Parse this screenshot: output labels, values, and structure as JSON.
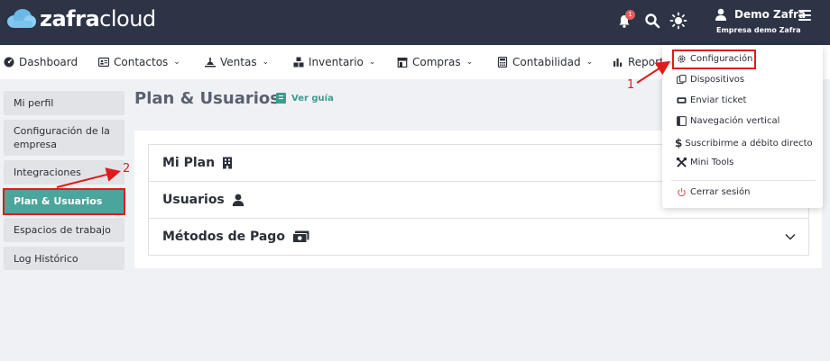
{
  "app": {
    "logo_bold": "zafra",
    "logo_light": "cloud",
    "notification_count": "1",
    "user_name": "Demo Zafra",
    "company_name": "Empresa demo Zafra"
  },
  "nav": {
    "items": [
      {
        "label": "Dashboard",
        "icon": "dashboard-icon",
        "dropdown": false
      },
      {
        "label": "Contactos",
        "icon": "contacts-icon",
        "dropdown": true
      },
      {
        "label": "Ventas",
        "icon": "sales-icon",
        "dropdown": true
      },
      {
        "label": "Inventario",
        "icon": "inventory-icon",
        "dropdown": true
      },
      {
        "label": "Compras",
        "icon": "store-icon",
        "dropdown": true
      },
      {
        "label": "Contabilidad",
        "icon": "calculator-icon",
        "dropdown": true
      },
      {
        "label": "Reporte",
        "icon": "chart-icon",
        "dropdown": false
      }
    ]
  },
  "sidebar": {
    "items": [
      {
        "label": "Mi perfil"
      },
      {
        "label": "Configuración de la empresa"
      },
      {
        "label": "Integraciones"
      },
      {
        "label": "Plan & Usuarios",
        "active": true
      },
      {
        "label": "Espacios de trabajo"
      },
      {
        "label": "Log Histórico"
      }
    ]
  },
  "main": {
    "title": "Plan & Usuarios",
    "guide_label": "Ver guía",
    "sections": [
      {
        "label": "Mi Plan",
        "icon": "building-icon"
      },
      {
        "label": "Usuarios",
        "icon": "user-icon"
      },
      {
        "label": "Métodos de Pago",
        "icon": "money-icon"
      }
    ]
  },
  "user_menu": {
    "items": [
      {
        "label": "Configuración",
        "icon": "gear-icon"
      },
      {
        "label": "Dispositivos",
        "icon": "devices-icon"
      },
      {
        "label": "Enviar ticket",
        "icon": "ticket-icon"
      },
      {
        "label": "Navegación vertical",
        "icon": "layout-icon"
      },
      {
        "label": "Suscribirme a débito directo",
        "icon": "dollar-icon"
      },
      {
        "label": "Mini Tools",
        "icon": "tools-icon"
      },
      {
        "label": "Cerrar sesión",
        "icon": "power-icon"
      }
    ]
  },
  "annotations": {
    "step1": "1",
    "step2": "2"
  },
  "colors": {
    "topbar": "#2d3446",
    "accent": "#4ba59c",
    "annotation": "#e01b1b"
  }
}
